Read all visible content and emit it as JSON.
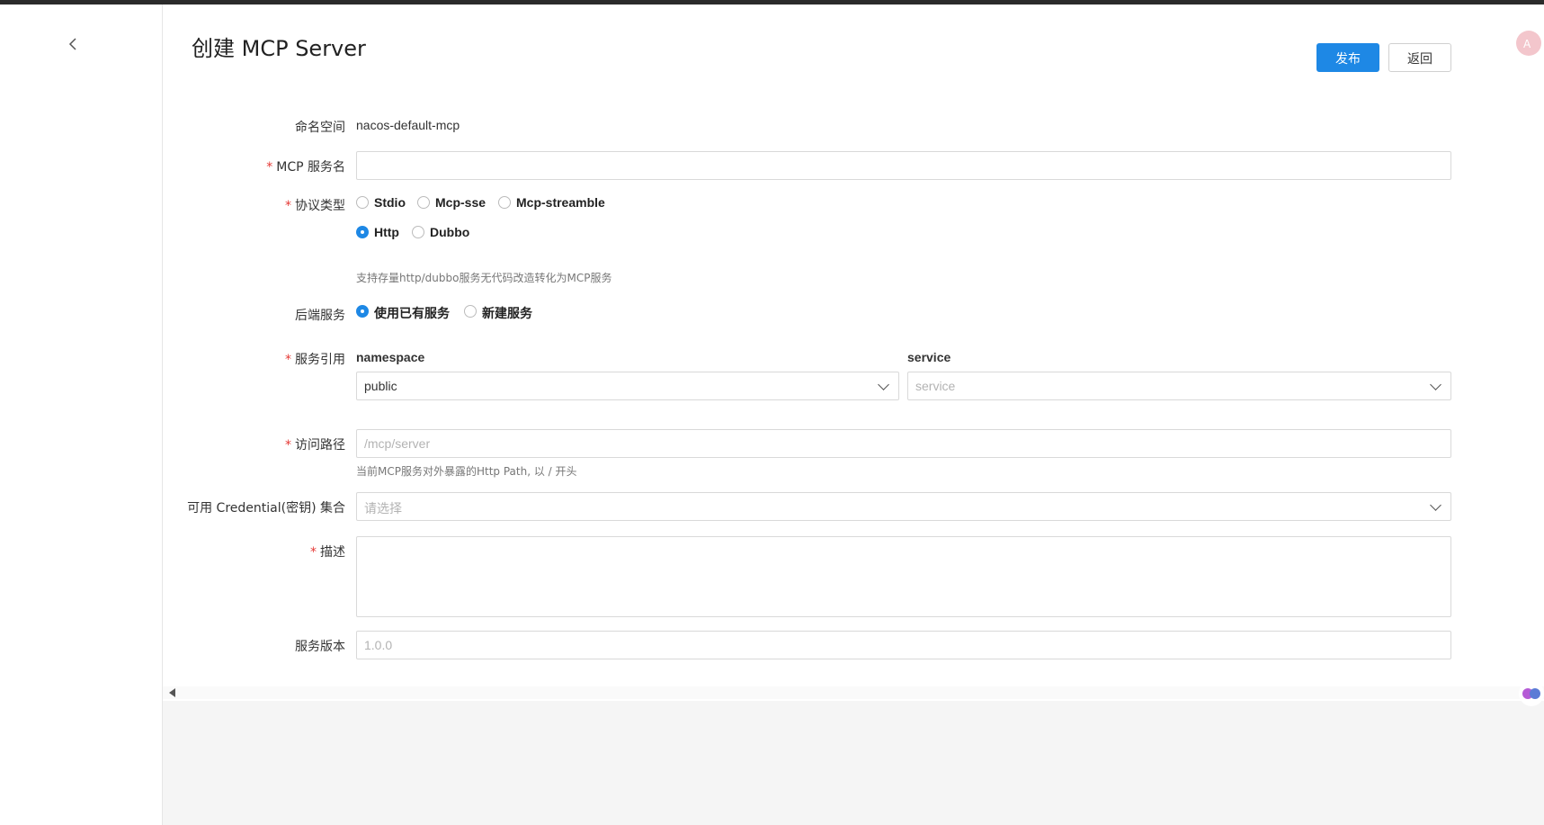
{
  "header": {
    "title": "创建 MCP Server",
    "publish_label": "发布",
    "back_label": "返回"
  },
  "form": {
    "namespace": {
      "label": "命名空间",
      "value": "nacos-default-mcp"
    },
    "service_name": {
      "label": "MCP 服务名",
      "required": "*",
      "value": ""
    },
    "protocol": {
      "label": "协议类型",
      "required": "*",
      "options": [
        "Stdio",
        "Mcp-sse",
        "Mcp-streamble",
        "Http",
        "Dubbo"
      ],
      "selected": "Http",
      "hint": "支持存量http/dubbo服务无代码改造转化为MCP服务"
    },
    "backend": {
      "label": "后端服务",
      "options": [
        "使用已有服务",
        "新建服务"
      ],
      "selected": "使用已有服务"
    },
    "service_ref": {
      "label": "服务引用",
      "required": "*",
      "namespace_label": "namespace",
      "namespace_value": "public",
      "service_label": "service",
      "service_placeholder": "service"
    },
    "access_path": {
      "label": "访问路径",
      "required": "*",
      "placeholder": "/mcp/server",
      "hint": "当前MCP服务对外暴露的Http Path, 以 / 开头"
    },
    "credential": {
      "label": "可用 Credential(密钥) 集合",
      "placeholder": "请选择"
    },
    "description": {
      "label": "描述",
      "required": "*",
      "value": ""
    },
    "version": {
      "label": "服务版本",
      "placeholder": "1.0.0"
    }
  },
  "icons": {
    "back": "chevron-left-icon",
    "translate": "translate-icon",
    "brain": "brain-icon"
  },
  "colors": {
    "primary": "#1e88e5",
    "required": "#e53935"
  }
}
